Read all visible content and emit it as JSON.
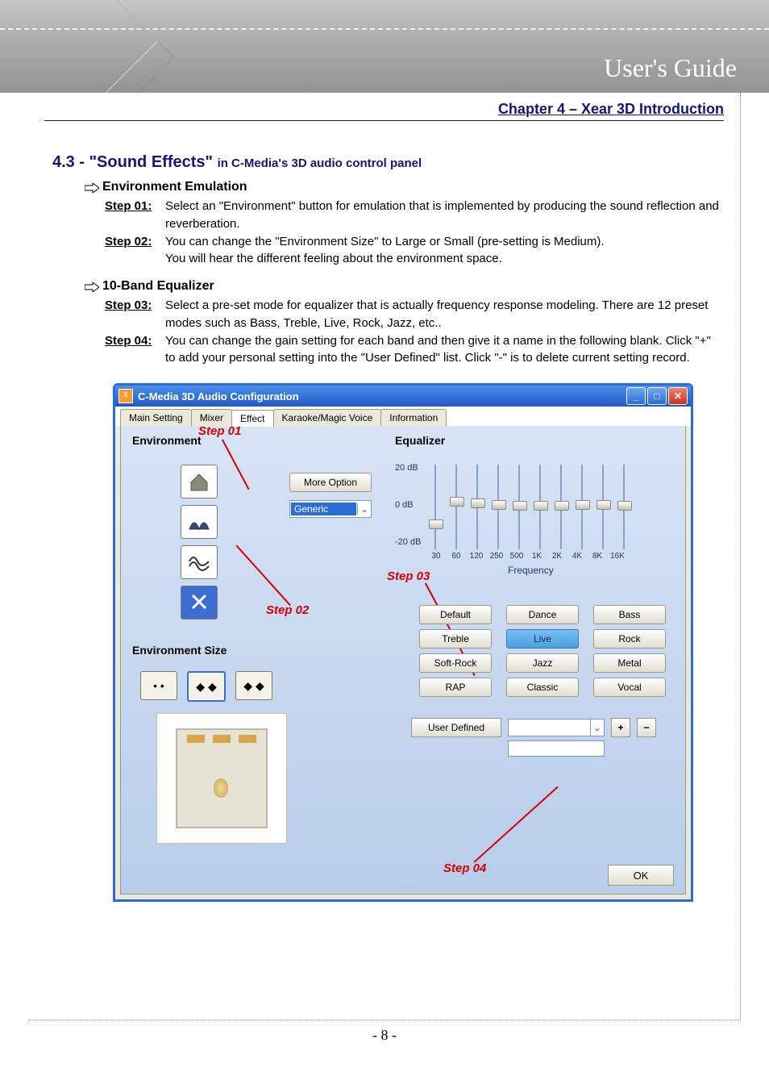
{
  "header": {
    "title": "User's Guide"
  },
  "chapter": "Chapter 4 – Xear 3D Introduction",
  "section": {
    "number": "4.3 - \"Sound Effects\"",
    "sub": "in C-Media's 3D audio control panel"
  },
  "sub1": {
    "title": "Environment Emulation",
    "step01_label": "Step 01:",
    "step01_text": "Select an \"Environment\" button for emulation that is implemented by producing the sound reflection and reverberation.",
    "step02_label": "Step 02:",
    "step02_text_a": "You can change the \"Environment Size\" to Large or Small (pre-setting is Medium).",
    "step02_text_b": "You will hear the different feeling about the environment space."
  },
  "sub2": {
    "title": "10-Band Equalizer",
    "step03_label": "Step 03:",
    "step03_text": "Select a pre-set mode for equalizer that is actually frequency response modeling. There are 12 preset modes such as Bass, Treble, Live, Rock, Jazz, etc..",
    "step04_label": "Step 04:",
    "step04_text": "You can change the gain setting for each band and then give it a name in the following blank. Click \"+\" to add your personal setting into the \"User Defined\" list. Click \"-\" is to delete current setting record."
  },
  "win": {
    "title": "C-Media 3D Audio Configuration",
    "tabs": [
      "Main Setting",
      "Mixer",
      "Effect",
      "Karaoke/Magic Voice",
      "Information"
    ],
    "active_tab": 2,
    "env_title": "Environment",
    "more_option": "More Option",
    "combo_value": "Generic",
    "env_size_title": "Environment Size",
    "eq_title": "Equalizer",
    "db_labels": [
      "20 dB",
      "0  dB",
      "-20 dB"
    ],
    "freqs": [
      "30",
      "60",
      "120",
      "250",
      "500",
      "1K",
      "2K",
      "4K",
      "8K",
      "16K"
    ],
    "freq_caption": "Frequency",
    "presets": [
      "Default",
      "Dance",
      "Bass",
      "Treble",
      "Live",
      "Rock",
      "Soft-Rock",
      "Jazz",
      "Metal",
      "RAP",
      "Classic",
      "Vocal"
    ],
    "active_preset": 4,
    "user_defined": "User  Defined",
    "plus": "+",
    "minus": "−",
    "ok": "OK",
    "ann": {
      "s1": "Step 01",
      "s2": "Step 02",
      "s3": "Step 03",
      "s4": "Step 04"
    }
  },
  "slider_offsets": [
    68,
    40,
    42,
    44,
    45,
    45,
    45,
    44,
    44,
    45
  ],
  "page_number": "- 8 -"
}
